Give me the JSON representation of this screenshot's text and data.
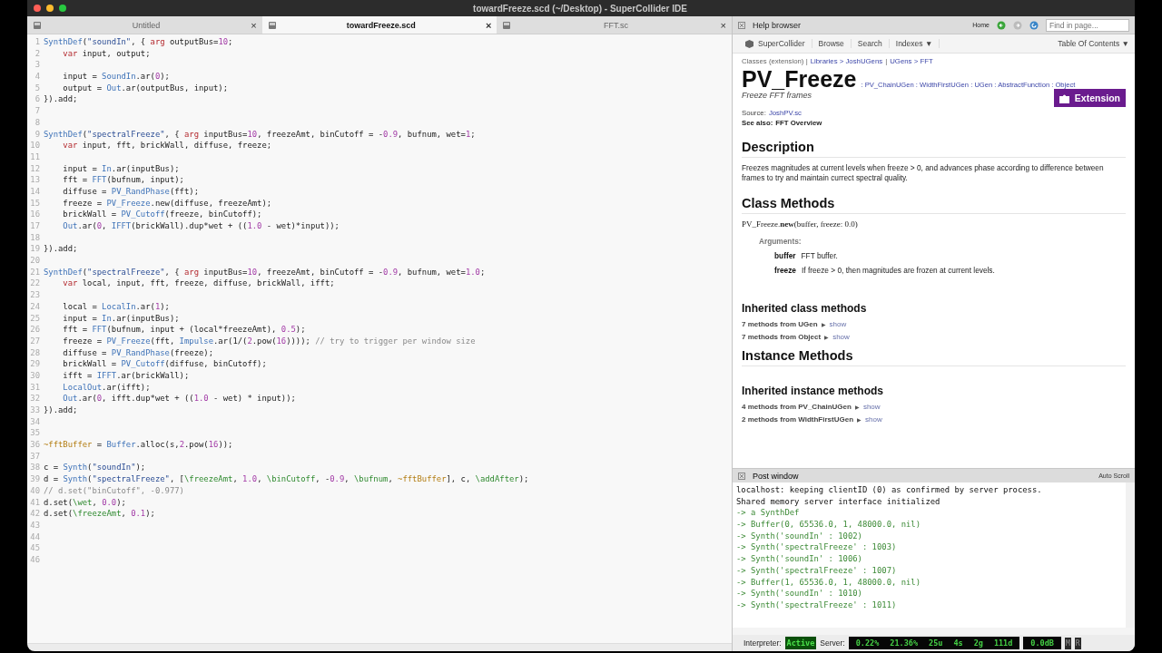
{
  "window": {
    "title": "towardFreeze.scd (~/Desktop) - SuperCollider IDE"
  },
  "editor": {
    "tabs": [
      {
        "label": "Untitled",
        "selected": false,
        "close": "×"
      },
      {
        "label": "towardFreeze.scd",
        "selected": true,
        "close": "×"
      },
      {
        "label": "FFT.sc",
        "selected": false,
        "close": "×"
      }
    ],
    "lines": [
      {
        "n": "1",
        "indented": false,
        "code": [
          {
            "kind": "class",
            "text": "SynthDef"
          },
          {
            "kind": "plain",
            "text": "("
          },
          {
            "kind": "string",
            "text": "\"soundIn\""
          },
          {
            "kind": "plain",
            "text": ", { "
          },
          {
            "kind": "keyword",
            "text": "arg"
          },
          {
            "kind": "plain",
            "text": " outputBus="
          },
          {
            "kind": "number",
            "text": "10"
          },
          {
            "kind": "plain",
            "text": ";"
          }
        ]
      },
      {
        "n": "2",
        "indented": true,
        "code": [
          {
            "kind": "keyword",
            "text": "var"
          },
          {
            "kind": "plain",
            "text": " input, output;"
          }
        ]
      },
      {
        "n": "3"
      },
      {
        "n": "4",
        "indented": true,
        "code": [
          {
            "kind": "plain",
            "text": "input = "
          },
          {
            "kind": "class",
            "text": "SoundIn"
          },
          {
            "kind": "plain",
            "text": ".ar("
          },
          {
            "kind": "number",
            "text": "0"
          },
          {
            "kind": "plain",
            "text": ");"
          }
        ]
      },
      {
        "n": "5",
        "indented": true,
        "code": [
          {
            "kind": "plain",
            "text": "output = "
          },
          {
            "kind": "class",
            "text": "Out"
          },
          {
            "kind": "plain",
            "text": ".ar(outputBus, input);"
          }
        ]
      },
      {
        "n": "6",
        "indented": false,
        "code": [
          {
            "kind": "plain",
            "text": "}).add;"
          }
        ]
      },
      {
        "n": "7"
      },
      {
        "n": "8"
      },
      {
        "n": "9",
        "indented": false,
        "code": [
          {
            "kind": "class",
            "text": "SynthDef"
          },
          {
            "kind": "plain",
            "text": "("
          },
          {
            "kind": "string",
            "text": "\"spectralFreeze\""
          },
          {
            "kind": "plain",
            "text": ", { "
          },
          {
            "kind": "keyword",
            "text": "arg"
          },
          {
            "kind": "plain",
            "text": " inputBus="
          },
          {
            "kind": "number",
            "text": "10"
          },
          {
            "kind": "plain",
            "text": ", freezeAmt, binCutoff = -"
          },
          {
            "kind": "number",
            "text": "0.9"
          },
          {
            "kind": "plain",
            "text": ", bufnum, wet="
          },
          {
            "kind": "number",
            "text": "1"
          },
          {
            "kind": "plain",
            "text": ";"
          }
        ]
      },
      {
        "n": "10",
        "indented": true,
        "code": [
          {
            "kind": "keyword",
            "text": "var"
          },
          {
            "kind": "plain",
            "text": " input, fft, brickWall, diffuse, freeze;"
          }
        ]
      },
      {
        "n": "11"
      },
      {
        "n": "12",
        "indented": true,
        "code": [
          {
            "kind": "plain",
            "text": "input = "
          },
          {
            "kind": "class",
            "text": "In"
          },
          {
            "kind": "plain",
            "text": ".ar(inputBus);"
          }
        ]
      },
      {
        "n": "13",
        "indented": true,
        "code": [
          {
            "kind": "plain",
            "text": "fft = "
          },
          {
            "kind": "class",
            "text": "FFT"
          },
          {
            "kind": "plain",
            "text": "(bufnum, input);"
          }
        ]
      },
      {
        "n": "14",
        "indented": true,
        "code": [
          {
            "kind": "plain",
            "text": "diffuse = "
          },
          {
            "kind": "class",
            "text": "PV_RandPhase"
          },
          {
            "kind": "plain",
            "text": "(fft);"
          }
        ]
      },
      {
        "n": "15",
        "indented": true,
        "code": [
          {
            "kind": "plain",
            "text": "freeze = "
          },
          {
            "kind": "class",
            "text": "PV_Freeze"
          },
          {
            "kind": "plain",
            "text": ".new(diffuse, freezeAmt);"
          }
        ]
      },
      {
        "n": "16",
        "indented": true,
        "code": [
          {
            "kind": "plain",
            "text": "brickWall = "
          },
          {
            "kind": "class",
            "text": "PV_Cutoff"
          },
          {
            "kind": "plain",
            "text": "(freeze, binCutoff);"
          }
        ]
      },
      {
        "n": "17",
        "indented": true,
        "code": [
          {
            "kind": "class",
            "text": "Out"
          },
          {
            "kind": "plain",
            "text": ".ar("
          },
          {
            "kind": "number",
            "text": "0"
          },
          {
            "kind": "plain",
            "text": ", "
          },
          {
            "kind": "class",
            "text": "IFFT"
          },
          {
            "kind": "plain",
            "text": "(brickWall).dup*wet + (("
          },
          {
            "kind": "number",
            "text": "1.0"
          },
          {
            "kind": "plain",
            "text": " - wet)*input));"
          }
        ]
      },
      {
        "n": "18"
      },
      {
        "n": "19",
        "indented": false,
        "code": [
          {
            "kind": "plain",
            "text": "}).add;"
          }
        ]
      },
      {
        "n": "20"
      },
      {
        "n": "21",
        "indented": false,
        "code": [
          {
            "kind": "class",
            "text": "SynthDef"
          },
          {
            "kind": "plain",
            "text": "("
          },
          {
            "kind": "string",
            "text": "\"spectralFreeze\""
          },
          {
            "kind": "plain",
            "text": ", { "
          },
          {
            "kind": "keyword",
            "text": "arg"
          },
          {
            "kind": "plain",
            "text": " inputBus="
          },
          {
            "kind": "number",
            "text": "10"
          },
          {
            "kind": "plain",
            "text": ", freezeAmt, binCutoff = -"
          },
          {
            "kind": "number",
            "text": "0.9"
          },
          {
            "kind": "plain",
            "text": ", bufnum, wet="
          },
          {
            "kind": "number",
            "text": "1.0"
          },
          {
            "kind": "plain",
            "text": ";"
          }
        ]
      },
      {
        "n": "22",
        "indented": true,
        "code": [
          {
            "kind": "keyword",
            "text": "var"
          },
          {
            "kind": "plain",
            "text": " local, input, fft, freeze, diffuse, brickWall, ifft;"
          }
        ]
      },
      {
        "n": "23"
      },
      {
        "n": "24",
        "indented": true,
        "code": [
          {
            "kind": "plain",
            "text": "local = "
          },
          {
            "kind": "class",
            "text": "LocalIn"
          },
          {
            "kind": "plain",
            "text": ".ar("
          },
          {
            "kind": "number",
            "text": "1"
          },
          {
            "kind": "plain",
            "text": ");"
          }
        ]
      },
      {
        "n": "25",
        "indented": true,
        "code": [
          {
            "kind": "plain",
            "text": "input = "
          },
          {
            "kind": "class",
            "text": "In"
          },
          {
            "kind": "plain",
            "text": ".ar(inputBus);"
          }
        ]
      },
      {
        "n": "26",
        "indented": true,
        "code": [
          {
            "kind": "plain",
            "text": "fft = "
          },
          {
            "kind": "class",
            "text": "FFT"
          },
          {
            "kind": "plain",
            "text": "(bufnum, input + (local*freezeAmt), "
          },
          {
            "kind": "number",
            "text": "0.5"
          },
          {
            "kind": "plain",
            "text": ");"
          }
        ]
      },
      {
        "n": "27",
        "indented": true,
        "code": [
          {
            "kind": "plain",
            "text": "freeze = "
          },
          {
            "kind": "class",
            "text": "PV_Freeze"
          },
          {
            "kind": "plain",
            "text": "(fft, "
          },
          {
            "kind": "class",
            "text": "Impulse"
          },
          {
            "kind": "plain",
            "text": ".ar(1/("
          },
          {
            "kind": "number",
            "text": "2"
          },
          {
            "kind": "plain",
            "text": ".pow("
          },
          {
            "kind": "number",
            "text": "16"
          },
          {
            "kind": "plain",
            "text": ")))); "
          },
          {
            "kind": "comment",
            "text": "// try to trigger per window size"
          }
        ]
      },
      {
        "n": "28",
        "indented": true,
        "code": [
          {
            "kind": "plain",
            "text": "diffuse = "
          },
          {
            "kind": "class",
            "text": "PV_RandPhase"
          },
          {
            "kind": "plain",
            "text": "(freeze);"
          }
        ]
      },
      {
        "n": "29",
        "indented": true,
        "code": [
          {
            "kind": "plain",
            "text": "brickWall = "
          },
          {
            "kind": "class",
            "text": "PV_Cutoff"
          },
          {
            "kind": "plain",
            "text": "(diffuse, binCutoff);"
          }
        ]
      },
      {
        "n": "30",
        "indented": true,
        "code": [
          {
            "kind": "plain",
            "text": "ifft = "
          },
          {
            "kind": "class",
            "text": "IFFT"
          },
          {
            "kind": "plain",
            "text": ".ar(brickWall);"
          }
        ]
      },
      {
        "n": "31",
        "indented": true,
        "code": [
          {
            "kind": "class",
            "text": "LocalOut"
          },
          {
            "kind": "plain",
            "text": ".ar(ifft);"
          }
        ]
      },
      {
        "n": "32",
        "indented": true,
        "code": [
          {
            "kind": "class",
            "text": "Out"
          },
          {
            "kind": "plain",
            "text": ".ar("
          },
          {
            "kind": "number",
            "text": "0"
          },
          {
            "kind": "plain",
            "text": ", ifft.dup*wet + (("
          },
          {
            "kind": "number",
            "text": "1.0"
          },
          {
            "kind": "plain",
            "text": " - wet) * input));"
          }
        ]
      },
      {
        "n": "33",
        "indented": false,
        "code": [
          {
            "kind": "plain",
            "text": "}).add;"
          }
        ]
      },
      {
        "n": "34"
      },
      {
        "n": "35"
      },
      {
        "n": "36",
        "indented": false,
        "code": [
          {
            "kind": "envvar",
            "text": "~fftBuffer"
          },
          {
            "kind": "plain",
            "text": " = "
          },
          {
            "kind": "class",
            "text": "Buffer"
          },
          {
            "kind": "plain",
            "text": ".alloc(s,"
          },
          {
            "kind": "number",
            "text": "2"
          },
          {
            "kind": "plain",
            "text": ".pow("
          },
          {
            "kind": "number",
            "text": "16"
          },
          {
            "kind": "plain",
            "text": "));"
          }
        ]
      },
      {
        "n": "37"
      },
      {
        "n": "38",
        "indented": false,
        "code": [
          {
            "kind": "plain",
            "text": "c = "
          },
          {
            "kind": "class",
            "text": "Synth"
          },
          {
            "kind": "plain",
            "text": "("
          },
          {
            "kind": "string",
            "text": "\"soundIn\""
          },
          {
            "kind": "plain",
            "text": ");"
          }
        ]
      },
      {
        "n": "39",
        "indented": false,
        "code": [
          {
            "kind": "plain",
            "text": "d = "
          },
          {
            "kind": "class",
            "text": "Synth"
          },
          {
            "kind": "plain",
            "text": "("
          },
          {
            "kind": "string",
            "text": "\"spectralFreeze\""
          },
          {
            "kind": "plain",
            "text": ", ["
          },
          {
            "kind": "symbol",
            "text": "\\freezeAmt"
          },
          {
            "kind": "plain",
            "text": ", "
          },
          {
            "kind": "number",
            "text": "1.0"
          },
          {
            "kind": "plain",
            "text": ", "
          },
          {
            "kind": "symbol",
            "text": "\\binCutoff"
          },
          {
            "kind": "plain",
            "text": ", -"
          },
          {
            "kind": "number",
            "text": "0.9"
          },
          {
            "kind": "plain",
            "text": ", "
          },
          {
            "kind": "symbol",
            "text": "\\bufnum"
          },
          {
            "kind": "plain",
            "text": ", "
          },
          {
            "kind": "envvar",
            "text": "~fftBuffer"
          },
          {
            "kind": "plain",
            "text": "], c, "
          },
          {
            "kind": "symbol",
            "text": "\\addAfter"
          },
          {
            "kind": "plain",
            "text": ");"
          }
        ]
      },
      {
        "n": "40",
        "indented": false,
        "code": [
          {
            "kind": "comment",
            "text": "// d.set(\"binCutoff\", -0.977)"
          }
        ]
      },
      {
        "n": "41",
        "indented": false,
        "code": [
          {
            "kind": "plain",
            "text": "d.set("
          },
          {
            "kind": "symbol",
            "text": "\\wet"
          },
          {
            "kind": "plain",
            "text": ", "
          },
          {
            "kind": "number",
            "text": "0.0"
          },
          {
            "kind": "plain",
            "text": ");"
          }
        ]
      },
      {
        "n": "42",
        "indented": false,
        "code": [
          {
            "kind": "plain",
            "text": "d.set("
          },
          {
            "kind": "symbol",
            "text": "\\freezeAmt"
          },
          {
            "kind": "plain",
            "text": ", "
          },
          {
            "kind": "number",
            "text": "0.1"
          },
          {
            "kind": "plain",
            "text": ");"
          }
        ]
      },
      {
        "n": "43"
      },
      {
        "n": "44"
      },
      {
        "n": "45"
      },
      {
        "n": "46"
      }
    ]
  },
  "help": {
    "title": "Help browser",
    "home": "Home",
    "find_placeholder": "Find in page...",
    "toolbar": [
      "SuperCollider",
      "Browse",
      "Search",
      "Indexes ▼"
    ],
    "toc": "Table Of Contents ▼",
    "breadcrumb": [
      {
        "text": "Classes (extension) |",
        "link": false
      },
      {
        "text": "Libraries > JoshUGens",
        "link": true
      },
      {
        "text": "|",
        "link": false
      },
      {
        "text": "UGens > FFT",
        "link": true
      }
    ],
    "class_name": "PV_Freeze",
    "superclasses": ": PV_ChainUGen : WidthFirstUGen : UGen : AbstractFunction : Object",
    "summary": "Freeze FFT frames",
    "badge": "Extension",
    "source_label": "Source:",
    "source": "JoshPV.sc",
    "see_also_label": "See also:",
    "see_also": "FFT Overview",
    "description_heading": "Description",
    "description": "Freezes magnitudes at current levels when freeze > 0, and advances phase according to difference between frames to try and maintain currect spectral quality.",
    "class_methods_heading": "Class Methods",
    "method_signature": "PV_Freeze.**new**(buffer, freeze: 0.0)",
    "arguments_label": "Arguments:",
    "arguments": [
      {
        "name": "buffer",
        "text": "FFT buffer."
      },
      {
        "name": "freeze",
        "text": "If freeze > 0, then magnitudes are frozen at current levels."
      }
    ],
    "inherited_class_heading": "Inherited class methods",
    "inherited_class": [
      {
        "text": "7 methods from UGen",
        "arrow": "▶",
        "link": "show"
      },
      {
        "text": "7 methods from Object",
        "arrow": "▶",
        "link": "show"
      }
    ],
    "instance_heading": "Instance Methods",
    "inherited_instance_heading": "Inherited instance methods",
    "inherited_instance": [
      {
        "text": "4 methods from PV_ChainUGen",
        "arrow": "▶",
        "link": "show"
      },
      {
        "text": "2 methods from WidthFirstUGen",
        "arrow": "▶",
        "link": "show"
      }
    ]
  },
  "post": {
    "title": "Post window",
    "auto_scroll": "Auto Scroll",
    "lines": [
      {
        "kind": "info",
        "text": "localhost: keeping clientID (0) as confirmed by server process."
      },
      {
        "kind": "info",
        "text": "Shared memory server interface initialized"
      },
      {
        "kind": "result",
        "text": "-> a SynthDef"
      },
      {
        "kind": "result",
        "text": "-> Buffer(0, 65536.0, 1, 48000.0, nil)"
      },
      {
        "kind": "result",
        "text": "-> Synth('soundIn' : 1002)"
      },
      {
        "kind": "result",
        "text": "-> Synth('spectralFreeze' : 1003)"
      },
      {
        "kind": "result",
        "text": "-> Synth('soundIn' : 1006)"
      },
      {
        "kind": "result",
        "text": "-> Synth('spectralFreeze' : 1007)"
      },
      {
        "kind": "result",
        "text": "-> Buffer(1, 65536.0, 1, 48000.0, nil)"
      },
      {
        "kind": "result",
        "text": "-> Synth('soundIn' : 1010)"
      },
      {
        "kind": "result",
        "text": "-> Synth('spectralFreeze' : 1011)"
      }
    ]
  },
  "status": {
    "interpreter_label": "Interpreter:",
    "interpreter_state": "Active",
    "server_label": "Server:",
    "server_stats": [
      "0.22%",
      "21.36%",
      "25u",
      "4s",
      "2g",
      "111d"
    ],
    "volume": "0.0dB",
    "mute": "M",
    "record": "R"
  }
}
